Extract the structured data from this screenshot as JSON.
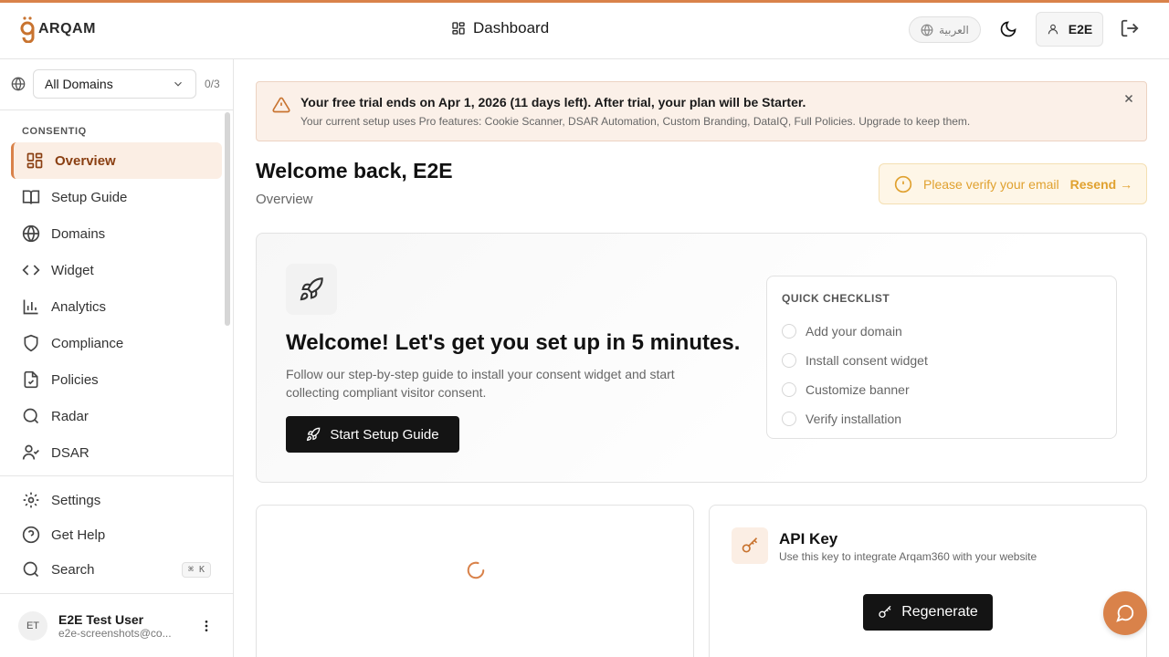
{
  "colors": {
    "accent": "#d9824a",
    "accent_dark": "#8a3f12",
    "warning": "#e0a12f",
    "button_dark": "#141414"
  },
  "header": {
    "logo_text": "ARQAM",
    "page_title": "Dashboard",
    "page_icon": "grid-icon",
    "language_label": "العربية",
    "user_label": "E2E"
  },
  "sidebar": {
    "domain_select": "All Domains",
    "domain_count": "0/3",
    "section_label": "CONSENTIQ",
    "items": [
      {
        "label": "Overview",
        "icon": "grid-icon",
        "active": true
      },
      {
        "label": "Setup Guide",
        "icon": "book-icon"
      },
      {
        "label": "Domains",
        "icon": "globe-icon"
      },
      {
        "label": "Widget",
        "icon": "code-icon"
      },
      {
        "label": "Analytics",
        "icon": "bar-chart-icon"
      },
      {
        "label": "Compliance",
        "icon": "shield-icon"
      },
      {
        "label": "Policies",
        "icon": "file-check-icon"
      },
      {
        "label": "Radar",
        "icon": "search-icon"
      },
      {
        "label": "DSAR",
        "icon": "user-check-icon"
      }
    ],
    "bottom_items": [
      {
        "label": "Settings",
        "icon": "gear-icon"
      },
      {
        "label": "Get Help",
        "icon": "help-circle-icon"
      },
      {
        "label": "Search",
        "icon": "search-icon",
        "shortcut": "⌘ K"
      }
    ],
    "user": {
      "initials": "ET",
      "name": "E2E Test User",
      "email": "e2e-screenshots@co..."
    }
  },
  "main": {
    "trial_banner": {
      "title": "Your free trial ends on Apr 1, 2026 (11 days left). After trial, your plan will be Starter.",
      "subtitle": "Your current setup uses Pro features: Cookie Scanner, DSAR Automation, Custom Branding, DataIQ, Full Policies. Upgrade to keep them."
    },
    "welcome_title": "Welcome back, E2E",
    "welcome_subtitle": "Overview",
    "verify": {
      "text": "Please verify your email",
      "action": "Resend →"
    },
    "setup_card": {
      "heading": "Welcome! Let's get you set up in 5 minutes.",
      "description": "Follow our step-by-step guide to install your consent widget and start collecting compliant visitor consent.",
      "button": "Start Setup Guide"
    },
    "checklist": {
      "title": "QUICK CHECKLIST",
      "items": [
        "Add your domain",
        "Install consent widget",
        "Customize banner",
        "Verify installation"
      ]
    },
    "api_card": {
      "title": "API Key",
      "subtitle": "Use this key to integrate Arqam360 with your website",
      "button": "Regenerate"
    }
  }
}
